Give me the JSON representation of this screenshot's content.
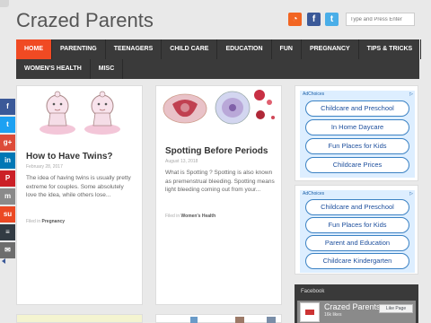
{
  "site": {
    "title": "Crazed Parents"
  },
  "header": {
    "icons": [
      {
        "name": "rss-icon",
        "glyph": "◔"
      },
      {
        "name": "facebook-icon",
        "glyph": "f"
      },
      {
        "name": "twitter-icon",
        "glyph": "t"
      }
    ],
    "search_placeholder": "Type and Press Enter"
  },
  "nav": {
    "row1": [
      "HOME",
      "PARENTING",
      "TEENAGERS",
      "CHILD CARE",
      "EDUCATION",
      "FUN",
      "PREGNANCY",
      "TIPS & TRICKS"
    ],
    "row2": [
      "WOMEN'S HEALTH",
      "MISC"
    ]
  },
  "share": {
    "buttons": [
      {
        "name": "facebook-share-button",
        "glyph": "f",
        "color": "#3b5998"
      },
      {
        "name": "twitter-share-button",
        "glyph": "t",
        "color": "#1da1f2"
      },
      {
        "name": "googleplus-share-button",
        "glyph": "g+",
        "color": "#dd4b39"
      },
      {
        "name": "linkedin-share-button",
        "glyph": "in",
        "color": "#0077b5"
      },
      {
        "name": "pinterest-share-button",
        "glyph": "P",
        "color": "#cb2027"
      },
      {
        "name": "mix-share-button",
        "glyph": "m",
        "color": "#8a8a8a"
      },
      {
        "name": "stumbleupon-share-button",
        "glyph": "su",
        "color": "#eb4924"
      },
      {
        "name": "buffer-share-button",
        "glyph": "≡",
        "color": "#323b43"
      },
      {
        "name": "email-share-button",
        "glyph": "✉",
        "color": "#6d6d6d"
      }
    ]
  },
  "posts": [
    {
      "title": "How to Have Twins?",
      "date": "February 28, 2017",
      "excerpt": "The idea of having twins is usually pretty extreme for couples. Some absolutely love the idea, while others lose...",
      "filed_prefix": "Filed in",
      "category": "Pregnancy"
    },
    {
      "title": "Spotting Before Periods",
      "date": "August 13, 2018",
      "excerpt": "What is Spotting ? Spotting is also known as premenstrual bleeding. Spotting means light bleeding coming out from your...",
      "filed_prefix": "Filed in",
      "category": "Women's Health"
    }
  ],
  "ads": {
    "label": "AdChoices",
    "close": "▷",
    "widget1": [
      "Childcare and Preschool",
      "In Home Daycare",
      "Fun Places for Kids",
      "Childcare Prices"
    ],
    "widget2": [
      "Childcare and Preschool",
      "Fun Places for Kids",
      "Parent and Education",
      "Childcare Kindergarten"
    ]
  },
  "facebook_widget": {
    "label": "Facebook",
    "page_name": "Crazed Parents",
    "likes": "16k likes",
    "like_button": "Like Page"
  },
  "colors": {
    "accent": "#f04a23",
    "nav_bg": "#3a3a3a",
    "ad_link": "#1c4e9c"
  }
}
